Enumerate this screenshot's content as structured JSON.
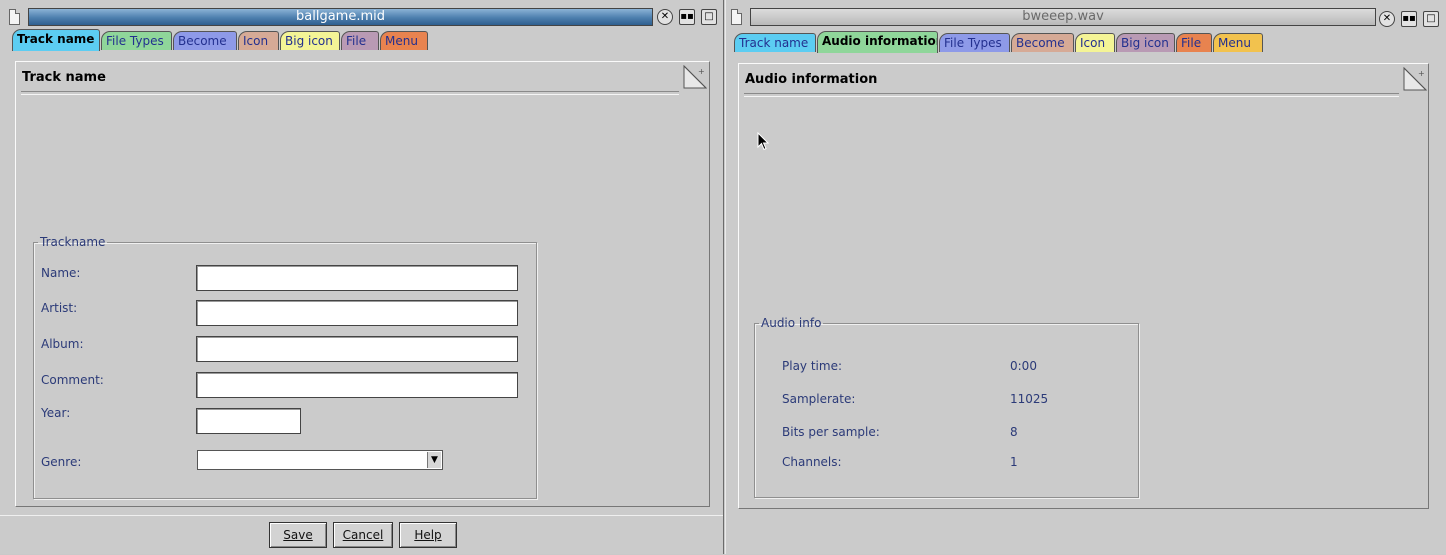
{
  "left_window": {
    "title": "ballgame.mid",
    "tabs": [
      {
        "label": "Track name",
        "color": "#5ccdf2"
      },
      {
        "label": "File Types",
        "color": "#8fd69a"
      },
      {
        "label": "Become",
        "color": "#8e9ae8"
      },
      {
        "label": "Icon",
        "color": "#d6aa96"
      },
      {
        "label": "Big icon",
        "color": "#f4f496"
      },
      {
        "label": "File",
        "color": "#b99ab4"
      },
      {
        "label": "Menu",
        "color": "#e8834f"
      }
    ],
    "panel_title": "Track name",
    "group_title": "Trackname",
    "fields": {
      "name_label": "Name:",
      "name_value": "",
      "artist_label": "Artist:",
      "artist_value": "",
      "album_label": "Album:",
      "album_value": "",
      "comment_label": "Comment:",
      "comment_value": "",
      "year_label": "Year:",
      "year_value": "",
      "genre_label": "Genre:",
      "genre_value": ""
    },
    "buttons": {
      "save": "Save",
      "cancel": "Cancel",
      "help": "Help"
    }
  },
  "right_window": {
    "title": "bweeep.wav",
    "tabs": [
      {
        "label": "Track name",
        "color": "#5ccdf2"
      },
      {
        "label": "Audio information",
        "color": "#8fd69a"
      },
      {
        "label": "File Types",
        "color": "#8e9ae8"
      },
      {
        "label": "Become",
        "color": "#d6aa96"
      },
      {
        "label": "Icon",
        "color": "#f4f496"
      },
      {
        "label": "Big icon",
        "color": "#b99ab4"
      },
      {
        "label": "File",
        "color": "#e8834f"
      },
      {
        "label": "Menu",
        "color": "#f2c24e"
      }
    ],
    "panel_title": "Audio information",
    "group_title": "Audio info",
    "info": {
      "play_time_label": "Play time:",
      "play_time_value": "0:00",
      "samplerate_label": "Samplerate:",
      "samplerate_value": "11025",
      "bits_label": "Bits per sample:",
      "bits_value": "8",
      "channels_label": "Channels:",
      "channels_value": "1"
    }
  },
  "icons": {
    "close": "close-icon",
    "iconify": "iconify-icon",
    "maximize": "maximize-icon",
    "document": "document-icon",
    "page_fold": "page-fold-icon",
    "dropdown": "chevron-down-icon",
    "cursor": "mouse-pointer-icon"
  },
  "colors": {
    "active_title_bar": "#4d7fae",
    "inactive_title_bar": "#c4c4c4",
    "window_bg": "#cbcbcb",
    "label_text": "#2b3a78"
  }
}
